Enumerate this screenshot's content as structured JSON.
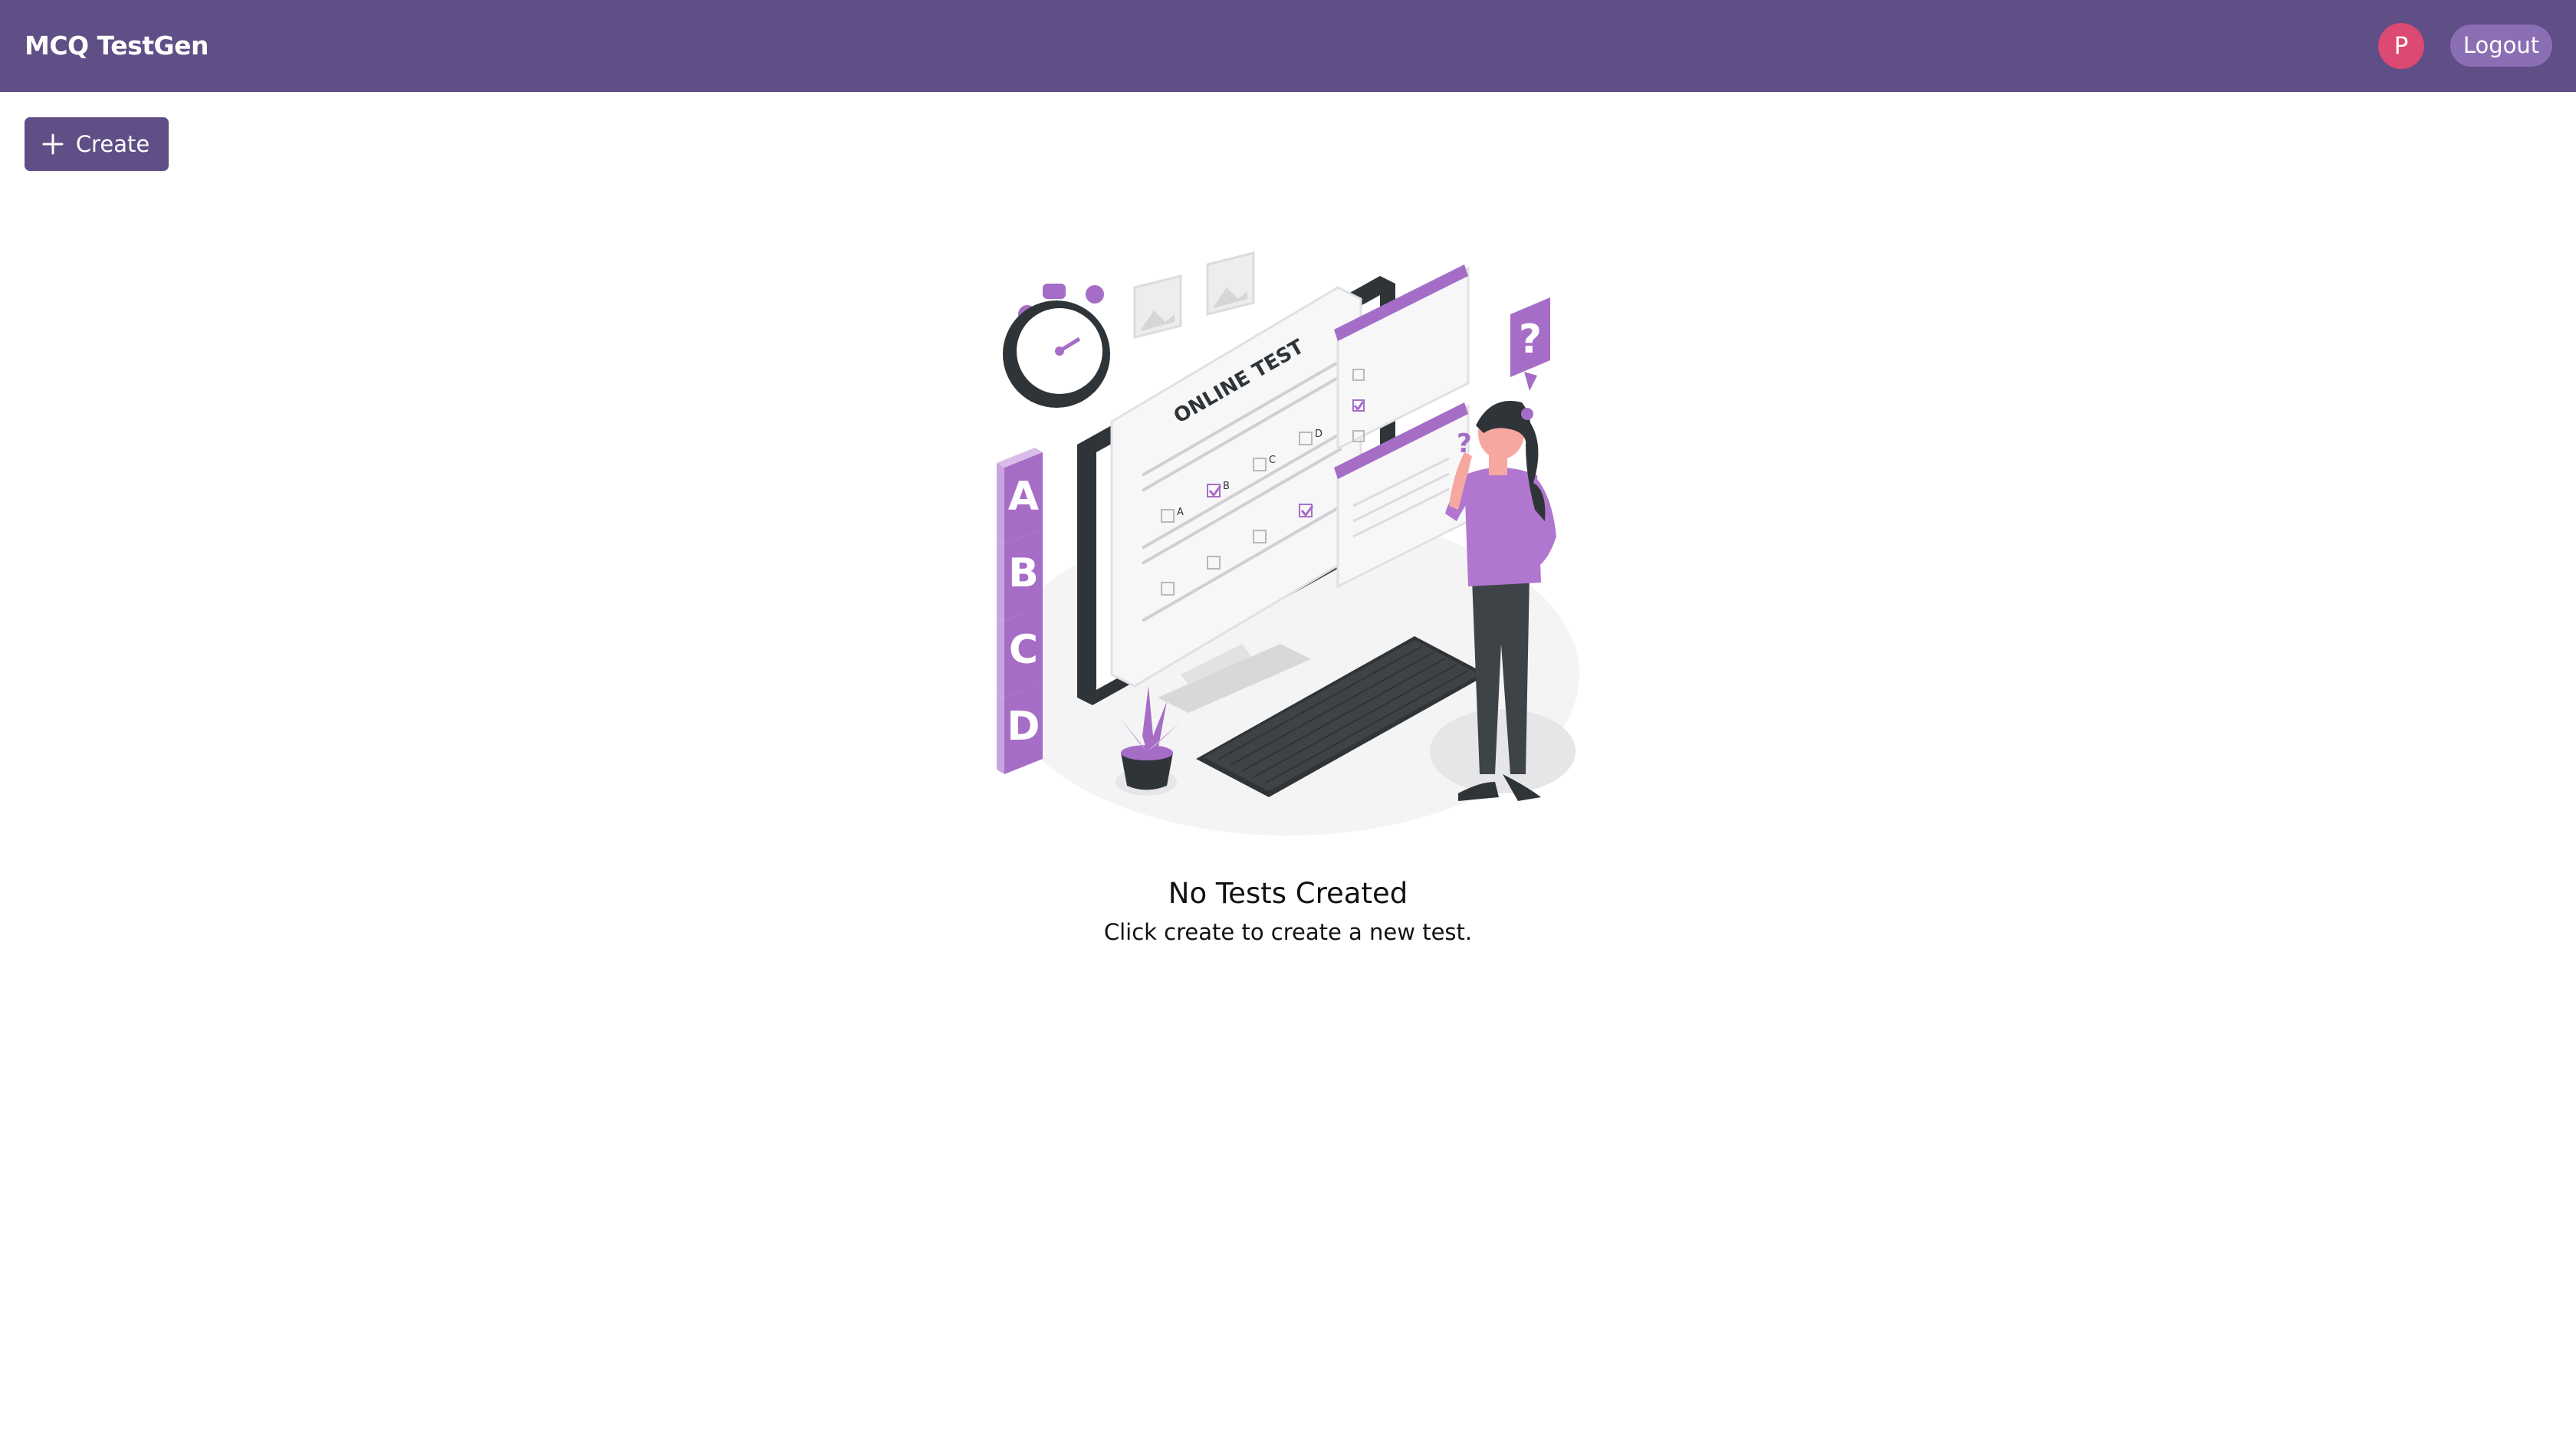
{
  "header": {
    "brand": "MCQ TestGen",
    "avatar_initial": "P",
    "logout_label": "Logout"
  },
  "toolbar": {
    "create_label": "Create"
  },
  "empty_state": {
    "title": "No Tests Created",
    "subtitle": "Click create to create a new test.",
    "illustration": {
      "screen_title": "ONLINE TEST",
      "option_letters": [
        "A",
        "B",
        "C",
        "D"
      ],
      "block_letters": [
        "A",
        "B",
        "C",
        "D"
      ],
      "question_mark": "?"
    }
  },
  "colors": {
    "header_bg": "#604e86",
    "accent_purple": "#a66dc7",
    "avatar_bg": "#dc4973",
    "logout_bg": "#8b6fb4",
    "dark": "#2f3438"
  }
}
